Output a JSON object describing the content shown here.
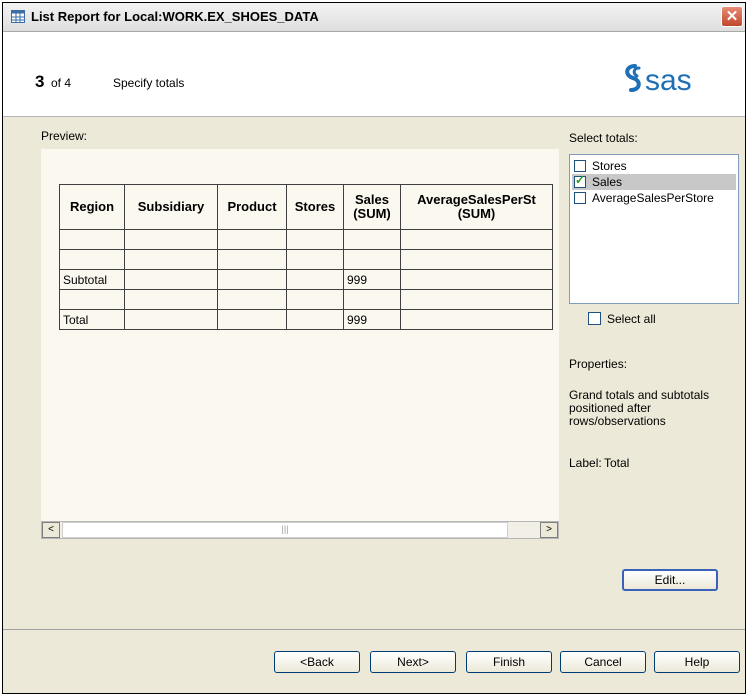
{
  "window": {
    "title": "List Report for Local:WORK.EX_SHOES_DATA",
    "close_glyph": "✕"
  },
  "header": {
    "step_number": "3",
    "step_of": "of 4",
    "step_description": "Specify totals",
    "logo_text": "sas"
  },
  "preview": {
    "label": "Preview:",
    "columns": [
      {
        "line1": "Region",
        "line2": ""
      },
      {
        "line1": "Subsidiary",
        "line2": ""
      },
      {
        "line1": "Product",
        "line2": ""
      },
      {
        "line1": "Stores",
        "line2": ""
      },
      {
        "line1": "Sales",
        "line2": "(SUM)"
      },
      {
        "line1": "AverageSalesPerSt",
        "line2": "(SUM)"
      }
    ],
    "rows": [
      [
        "",
        "",
        "",
        "",
        "",
        ""
      ],
      [
        "",
        "",
        "",
        "",
        "",
        ""
      ],
      [
        "Subtotal",
        "",
        "",
        "",
        "999",
        ""
      ],
      [
        "",
        "",
        "",
        "",
        "",
        ""
      ],
      [
        "Total",
        "",
        "",
        "",
        "999",
        ""
      ]
    ],
    "scroll_left": "<",
    "scroll_right": ">",
    "scroll_grip": "|||"
  },
  "totals": {
    "label": "Select totals:",
    "items": [
      {
        "label": "Stores",
        "checked": false,
        "selected": false
      },
      {
        "label": "Sales",
        "checked": true,
        "selected": true
      },
      {
        "label": "AverageSalesPerStore",
        "checked": false,
        "selected": false
      }
    ],
    "select_all_label": "Select all"
  },
  "properties": {
    "label": "Properties:",
    "description_lines": [
      "Grand totals and subtotals",
      "positioned after",
      "rows/observations"
    ],
    "label_key": "Label:",
    "label_value": "Total"
  },
  "buttons": {
    "edit": "Edit...",
    "back": "<Back",
    "next": "Next>",
    "finish": "Finish",
    "cancel": "Cancel",
    "help": "Help"
  }
}
